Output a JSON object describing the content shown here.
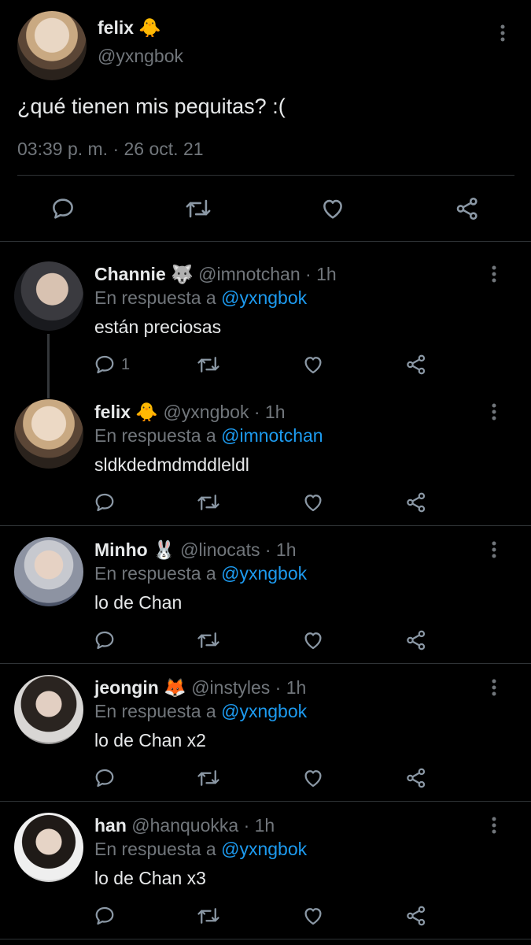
{
  "main_tweet": {
    "author_name": "felix",
    "author_emoji": "🐥",
    "handle": "@yxngbok",
    "text": "¿qué tienen mis pequitas? :(",
    "timestamp": "03:39 p. m. · 26 oct. 21"
  },
  "replies": [
    {
      "name": "Channie",
      "emoji": "🐺",
      "handle": "@imnotchan",
      "time": "· 1h",
      "reply_prefix": "En respuesta a",
      "reply_to": "@yxngbok",
      "text": "están preciosas",
      "reply_count": "1"
    },
    {
      "name": "felix",
      "emoji": "🐥",
      "handle": "@yxngbok",
      "time": "· 1h",
      "reply_prefix": "En respuesta a",
      "reply_to": "@imnotchan",
      "text": "sldkdedmdmddleldl",
      "reply_count": ""
    },
    {
      "name": "Minho",
      "emoji": "🐰",
      "handle": "@linocats",
      "time": "· 1h",
      "reply_prefix": "En respuesta a",
      "reply_to": "@yxngbok",
      "text": "lo de Chan",
      "reply_count": ""
    },
    {
      "name": "jeongin",
      "emoji": "🦊",
      "handle": "@instyles",
      "time": "· 1h",
      "reply_prefix": "En respuesta a",
      "reply_to": "@yxngbok",
      "text": "lo de Chan x2",
      "reply_count": ""
    },
    {
      "name": "han",
      "emoji": "",
      "handle": "@hanquokka",
      "time": "· 1h",
      "reply_prefix": "En respuesta a",
      "reply_to": "@yxngbok",
      "text": "lo de Chan x3",
      "reply_count": ""
    }
  ],
  "colors": {
    "background": "#000000",
    "text": "#e7e9ea",
    "muted": "#71767b",
    "link": "#1d9bf0",
    "separator": "#2f3336"
  },
  "icons": [
    "reply-icon",
    "retweet-icon",
    "like-icon",
    "share-icon",
    "more-options-icon"
  ]
}
